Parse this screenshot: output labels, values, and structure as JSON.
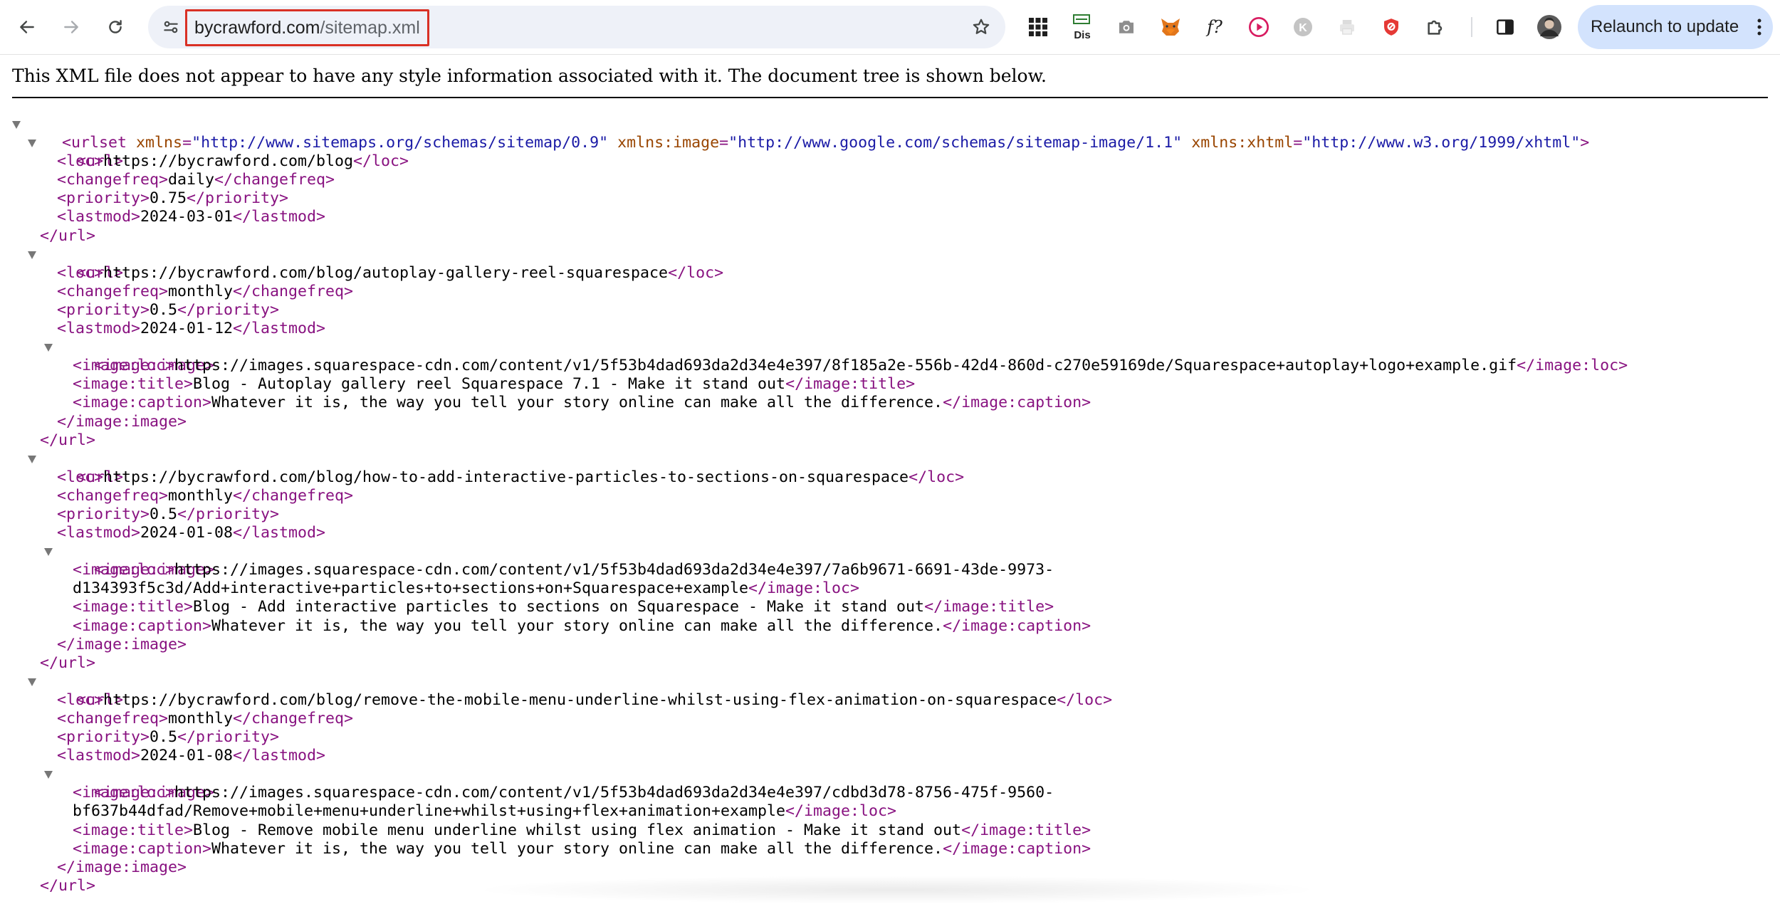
{
  "browser": {
    "url_domain": "bycrawford.com",
    "url_path": "/sitemap.xml",
    "relaunch_label": "Relaunch to update",
    "extensions": [
      {
        "icon": "apps-grid-icon"
      },
      {
        "icon": "dis-extension-icon",
        "label": "Dis"
      },
      {
        "icon": "camera-icon"
      },
      {
        "icon": "fox-extension-icon"
      },
      {
        "icon": "font-detect-icon",
        "label": "f?"
      },
      {
        "icon": "play-circle-icon"
      },
      {
        "icon": "k-extension-icon",
        "label": "K"
      },
      {
        "icon": "printer-icon"
      },
      {
        "icon": "shield-extension-icon"
      },
      {
        "icon": "puzzle-icon"
      }
    ],
    "colors": {
      "accent": "#d3e3fd",
      "highlight_border": "#d93025",
      "omnibox": "#eef1f8"
    }
  },
  "viewer": {
    "info": "This XML file does not appear to have any style information associated with it. The document tree is shown below.",
    "colors": {
      "tag": "#881280",
      "attr_name": "#994500",
      "attr_value": "#1a1aa6"
    }
  },
  "xml": {
    "urlset_open": "<urlset",
    "ns_attr": "xmlns",
    "ns_val": "\"http://www.sitemaps.org/schemas/sitemap/0.9\"",
    "img_attr": "xmlns:image",
    "img_val": "\"http://www.google.com/schemas/sitemap-image/1.1\"",
    "xhtml_attr": "xmlns:xhtml",
    "xhtml_val": "\"http://www.w3.org/1999/xhtml\"",
    "tag_end": ">",
    "url_open": "<url>",
    "url_close": "</url>",
    "loc_open": "<loc>",
    "loc_close": "</loc>",
    "changefreq_open": "<changefreq>",
    "changefreq_close": "</changefreq>",
    "priority_open": "<priority>",
    "priority_close": "</priority>",
    "lastmod_open": "<lastmod>",
    "lastmod_close": "</lastmod>",
    "image_open": "<image:image>",
    "image_close": "</image:image>",
    "imgloc_open": "<image:loc>",
    "imgloc_close": "</image:loc>",
    "imgtitle_open": "<image:title>",
    "imgtitle_close": "</image:title>",
    "imgcaption_open": "<image:caption>",
    "imgcaption_close": "</image:caption>",
    "caption": "Whatever it is, the way you tell your story online can make all the difference.",
    "urls": [
      {
        "loc": "https://bycrawford.com/blog",
        "changefreq": "daily",
        "priority": "0.75",
        "lastmod": "2024-03-01"
      },
      {
        "loc": "https://bycrawford.com/blog/autoplay-gallery-reel-squarespace",
        "changefreq": "monthly",
        "priority": "0.5",
        "lastmod": "2024-01-12",
        "image_loc": "https://images.squarespace-cdn.com/content/v1/5f53b4dad693da2d34e4e397/8f185a2e-556b-42d4-860d-c270e59169de/Squarespace+autoplay+logo+example.gif",
        "image_title": "Blog - Autoplay gallery reel Squarespace 7.1 - Make it stand out"
      },
      {
        "loc": "https://bycrawford.com/blog/how-to-add-interactive-particles-to-sections-on-squarespace",
        "changefreq": "monthly",
        "priority": "0.5",
        "lastmod": "2024-01-08",
        "image_loc_1": "https://images.squarespace-cdn.com/content/v1/5f53b4dad693da2d34e4e397/7a6b9671-6691-43de-9973-",
        "image_loc_2": "d134393f5c3d/Add+interactive+particles+to+sections+on+Squarespace+example",
        "image_title": "Blog - Add interactive particles to sections on Squarespace - Make it stand out"
      },
      {
        "loc": "https://bycrawford.com/blog/remove-the-mobile-menu-underline-whilst-using-flex-animation-on-squarespace",
        "changefreq": "monthly",
        "priority": "0.5",
        "lastmod": "2024-01-08",
        "image_loc_1": "https://images.squarespace-cdn.com/content/v1/5f53b4dad693da2d34e4e397/cdbd3d78-8756-475f-9560-",
        "image_loc_2": "bf637b44dfad/Remove+mobile+menu+underline+whilst+using+flex+animation+example",
        "image_title": "Blog - Remove mobile menu underline whilst using flex animation - Make it stand out"
      }
    ]
  }
}
